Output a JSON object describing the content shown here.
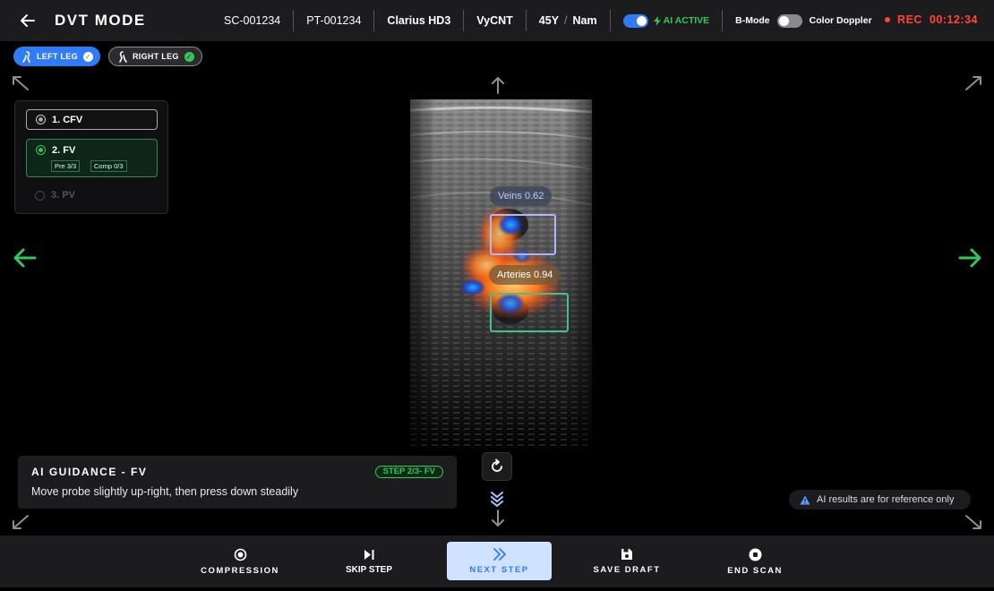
{
  "header": {
    "title": "DVT MODE",
    "session_id": "SC-001234",
    "patient_id": "PT-001234",
    "device": "Clarius HD3",
    "patient_name": "VyCNT",
    "age": "45Y",
    "gender": "Nam",
    "ai_toggle_label": "AI ACTIVE",
    "ai_enabled": true,
    "mode_bmode": "B-Mode",
    "mode_doppler": "Color Doppler",
    "doppler_enabled": false,
    "rec_label": "REC",
    "rec_time": "00:12:34"
  },
  "legs": [
    {
      "label": "LEFT LEG",
      "selected": true,
      "done": true
    },
    {
      "label": "RIGHT LEG",
      "selected": false,
      "done": true
    }
  ],
  "vessels": [
    {
      "label": "1. CFV",
      "state": "done"
    },
    {
      "label": "2. FV",
      "state": "active",
      "tags": [
        "Pre 3/3",
        "Comp 0/3"
      ]
    },
    {
      "label": "3. PV",
      "state": "pending"
    }
  ],
  "detections": [
    {
      "label": "Veins 0.62",
      "class": "vein",
      "color": "#a9b8ff"
    },
    {
      "label": "Arteries  0.94",
      "class": "artery",
      "color": "#46c08a"
    }
  ],
  "guidance": {
    "title": "AI GUIDANCE - FV",
    "step": "STEP 2/3- FV",
    "text": "Move probe slightly up-right, then press down steadily"
  },
  "disclaimer": "AI results are for reference only",
  "actions": {
    "compression": "COMPRESSION",
    "skip": "SKIP STEP",
    "next": "NEXT STEP",
    "save": "SAVE DRAFT",
    "end": "END SCAN"
  },
  "colors": {
    "accent": "#2f7cf6",
    "success": "#34c759",
    "record": "#ff453a",
    "nav_arrow": "#34c759"
  }
}
